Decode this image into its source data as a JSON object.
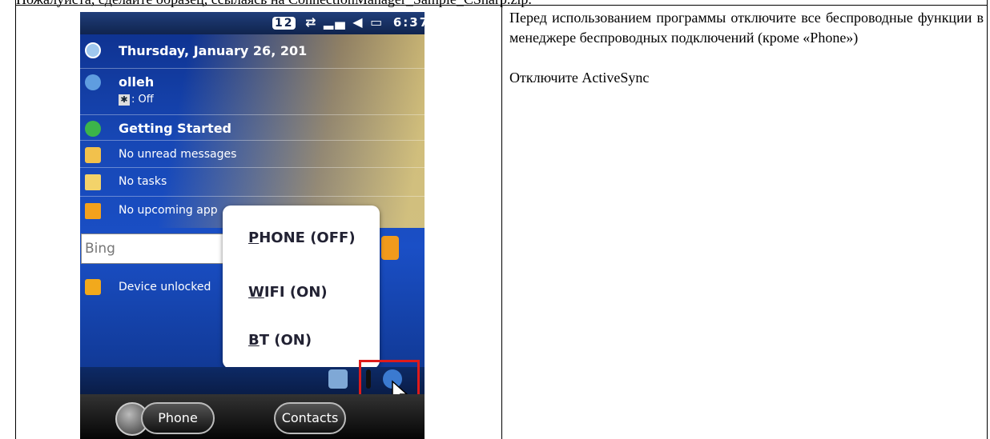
{
  "top_text": "Пожалуйста, сделайте образец, ссылаясь на ConnectionManager_Sample_CSharp.zip.",
  "right_text": {
    "paragraph1": "Перед использованием программы отключите все беспроводные функции в менеджере беспроводных подключений (кроме «Phone»)",
    "paragraph2": "Отключите ActiveSync"
  },
  "phone": {
    "status": {
      "badge": "12",
      "time": "6:37"
    },
    "date": "Thursday, January 26, 201",
    "operator": "olleh",
    "bt_status": ": Off",
    "getting_started": "Getting Started",
    "messages": "No unread messages",
    "tasks": "No tasks",
    "appointments": "No upcoming app",
    "search_placeholder": "Bing",
    "device": "Device unlocked",
    "popup": {
      "phone_prefix": "P",
      "phone_rest": "HONE (OFF)",
      "wifi_prefix": "W",
      "wifi_rest": "IFI (ON)",
      "bt_prefix": "B",
      "bt_rest": "T (ON)"
    },
    "softkeys": {
      "phone": "Phone",
      "contacts": "Contacts"
    }
  },
  "colors": {
    "highlight": "#e01b1b",
    "accent": "#f19a1c"
  }
}
